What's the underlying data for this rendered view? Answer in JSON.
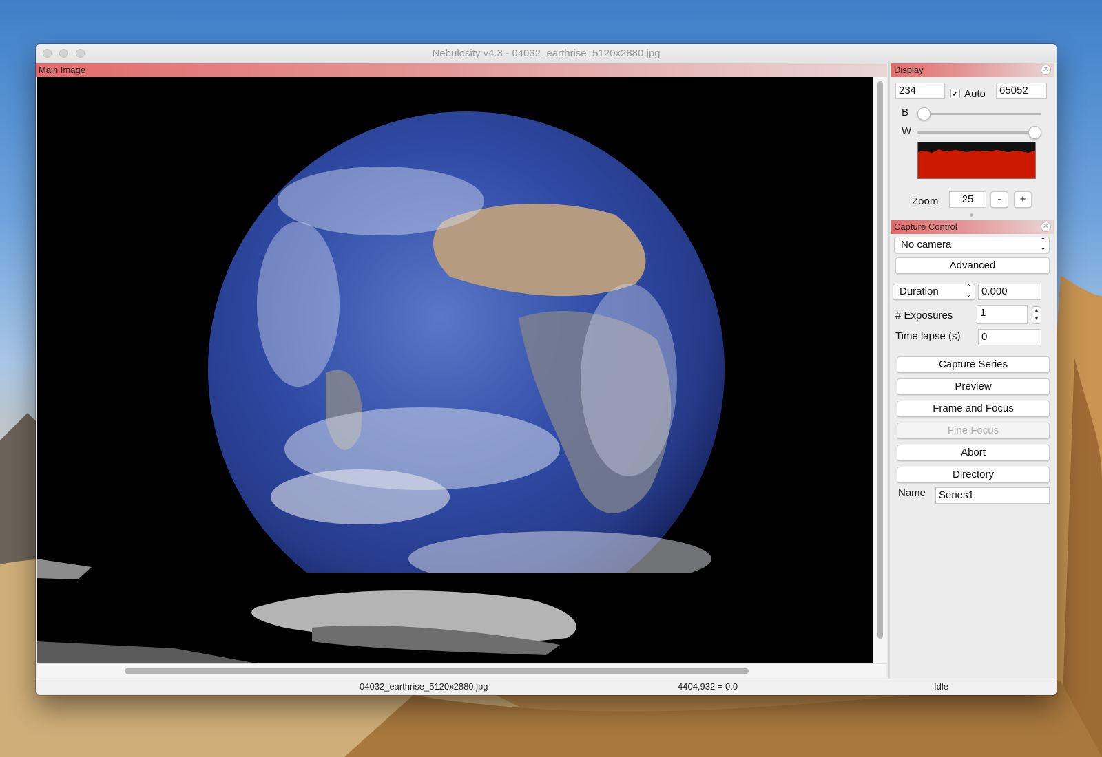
{
  "window": {
    "title": "Nebulosity v4.3 - 04032_earthrise_5120x2880.jpg"
  },
  "main_image": {
    "header": "Main Image"
  },
  "display": {
    "header": "Display",
    "black_value": "234",
    "auto_checked": true,
    "auto_check_glyph": "✓",
    "auto_label": "Auto",
    "white_value": "65052",
    "b_label": "B",
    "w_label": "W",
    "b_slider_fraction": 0.0,
    "w_slider_fraction": 1.0,
    "zoom_label": "Zoom",
    "zoom_value": "25",
    "zoom_minus": "-",
    "zoom_plus": "+",
    "histogram_color": "#cc1a00"
  },
  "capture": {
    "header": "Capture Control",
    "camera": "No camera",
    "advanced": "Advanced",
    "duration_mode": "Duration",
    "duration_value": "0.000",
    "exposures_label": "# Exposures",
    "exposures_value": "1",
    "timelapse_label": "Time lapse (s)",
    "timelapse_value": "0",
    "buttons": {
      "capture_series": "Capture Series",
      "preview": "Preview",
      "frame_focus": "Frame and Focus",
      "fine_focus": "Fine Focus",
      "abort": "Abort",
      "directory": "Directory"
    },
    "name_label": "Name",
    "name_value": "Series1"
  },
  "status": {
    "filename": "04032_earthrise_5120x2880.jpg",
    "pixel_info": "4404,932 = 0.0",
    "state": "Idle"
  },
  "icons": {
    "close": "close-icon",
    "chevron": "chevron-updown-icon",
    "spin": "stepper-icon"
  },
  "colors": {
    "panel_header_accent": "#e36b6b"
  }
}
